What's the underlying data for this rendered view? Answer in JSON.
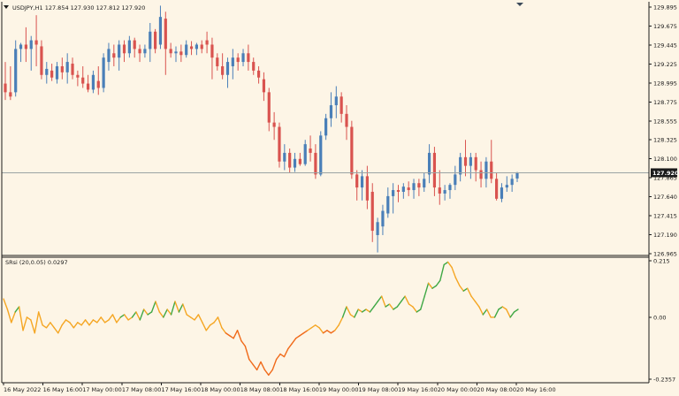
{
  "main_panel": {
    "header": "USDJPY,H1  127.854 127.930 127.812 127.920",
    "current_price": "127.920",
    "price_axis_labels": [
      "129.895",
      "129.675",
      "129.445",
      "129.225",
      "128.995",
      "128.775",
      "128.555",
      "128.325",
      "128.100",
      "127.865",
      "127.640",
      "127.415",
      "127.190",
      "126.965"
    ]
  },
  "indicator_panel": {
    "header": "SRsi (20,0.05) 0.0297",
    "axis_labels": [
      "0.215",
      "0.00",
      "-0.2357"
    ]
  },
  "time_axis_labels": [
    "16 May 2022",
    "16 May 16:00",
    "17 May 00:00",
    "17 May 08:00",
    "17 May 16:00",
    "18 May 00:00",
    "18 May 08:00",
    "18 May 16:00",
    "19 May 00:00",
    "19 May 08:00",
    "19 May 16:00",
    "20 May 00:00",
    "20 May 08:00",
    "20 May 16:00"
  ],
  "colors": {
    "background": "#fdf5e6",
    "bull_candle": "#4a7fb8",
    "bear_candle": "#d9534f",
    "indicator_up": "#3fa845",
    "indicator_neutral": "#f5a623",
    "indicator_down": "#f06a1a",
    "current_price_line": "#9aa4a4"
  },
  "chart_data": [
    {
      "type": "candlestick",
      "symbol": "USDJPY",
      "timeframe": "H1",
      "ylim": [
        126.965,
        129.895
      ],
      "candles": [
        {
          "o": 128.95,
          "h": 129.2,
          "l": 128.76,
          "c": 128.85
        },
        {
          "o": 128.85,
          "h": 129.15,
          "l": 128.76,
          "c": 128.8
        },
        {
          "o": 128.85,
          "h": 129.45,
          "l": 128.8,
          "c": 129.35
        },
        {
          "o": 129.35,
          "h": 129.42,
          "l": 129.2,
          "c": 129.4
        },
        {
          "o": 129.4,
          "h": 129.6,
          "l": 129.2,
          "c": 129.35
        },
        {
          "o": 129.35,
          "h": 129.5,
          "l": 129.1,
          "c": 129.45
        },
        {
          "o": 129.45,
          "h": 129.74,
          "l": 129.15,
          "c": 129.4
        },
        {
          "o": 129.38,
          "h": 129.45,
          "l": 129.0,
          "c": 129.05
        },
        {
          "o": 129.05,
          "h": 129.2,
          "l": 128.95,
          "c": 129.12
        },
        {
          "o": 129.1,
          "h": 129.18,
          "l": 128.98,
          "c": 129.02
        },
        {
          "o": 129.0,
          "h": 129.2,
          "l": 128.95,
          "c": 129.15
        },
        {
          "o": 129.15,
          "h": 129.25,
          "l": 129.0,
          "c": 129.08
        },
        {
          "o": 129.08,
          "h": 129.3,
          "l": 128.95,
          "c": 129.2
        },
        {
          "o": 129.18,
          "h": 129.25,
          "l": 129.0,
          "c": 129.05
        },
        {
          "o": 129.05,
          "h": 129.1,
          "l": 128.92,
          "c": 129.02
        },
        {
          "o": 129.02,
          "h": 129.15,
          "l": 128.9,
          "c": 128.95
        },
        {
          "o": 128.95,
          "h": 129.05,
          "l": 128.85,
          "c": 128.88
        },
        {
          "o": 128.88,
          "h": 129.1,
          "l": 128.84,
          "c": 129.05
        },
        {
          "o": 128.98,
          "h": 129.15,
          "l": 128.82,
          "c": 128.9
        },
        {
          "o": 128.9,
          "h": 129.3,
          "l": 128.85,
          "c": 129.25
        },
        {
          "o": 129.2,
          "h": 129.42,
          "l": 129.1,
          "c": 129.35
        },
        {
          "o": 129.3,
          "h": 129.4,
          "l": 129.15,
          "c": 129.25
        },
        {
          "o": 129.25,
          "h": 129.45,
          "l": 129.1,
          "c": 129.4
        },
        {
          "o": 129.4,
          "h": 129.45,
          "l": 129.2,
          "c": 129.3
        },
        {
          "o": 129.3,
          "h": 129.5,
          "l": 129.25,
          "c": 129.45
        },
        {
          "o": 129.45,
          "h": 129.48,
          "l": 129.25,
          "c": 129.35
        },
        {
          "o": 129.35,
          "h": 129.4,
          "l": 129.2,
          "c": 129.3
        },
        {
          "o": 129.3,
          "h": 129.4,
          "l": 129.25,
          "c": 129.35
        },
        {
          "o": 129.35,
          "h": 129.65,
          "l": 129.2,
          "c": 129.55
        },
        {
          "o": 129.55,
          "h": 129.58,
          "l": 129.3,
          "c": 129.35
        },
        {
          "o": 129.4,
          "h": 129.85,
          "l": 129.35,
          "c": 129.72
        },
        {
          "o": 129.7,
          "h": 129.78,
          "l": 129.05,
          "c": 129.35
        },
        {
          "o": 129.35,
          "h": 129.42,
          "l": 129.25,
          "c": 129.3
        },
        {
          "o": 129.3,
          "h": 129.38,
          "l": 129.2,
          "c": 129.32
        },
        {
          "o": 129.32,
          "h": 129.4,
          "l": 129.2,
          "c": 129.28
        },
        {
          "o": 129.28,
          "h": 129.45,
          "l": 129.25,
          "c": 129.4
        },
        {
          "o": 129.38,
          "h": 129.44,
          "l": 129.28,
          "c": 129.35
        },
        {
          "o": 129.35,
          "h": 129.42,
          "l": 129.28,
          "c": 129.4
        },
        {
          "o": 129.4,
          "h": 129.45,
          "l": 129.3,
          "c": 129.35
        },
        {
          "o": 129.45,
          "h": 129.55,
          "l": 129.3,
          "c": 129.4
        },
        {
          "o": 129.4,
          "h": 129.48,
          "l": 129.0,
          "c": 129.25
        },
        {
          "o": 129.25,
          "h": 129.3,
          "l": 129.1,
          "c": 129.15
        },
        {
          "o": 129.15,
          "h": 129.3,
          "l": 129.0,
          "c": 129.05
        },
        {
          "o": 129.05,
          "h": 129.25,
          "l": 128.9,
          "c": 129.2
        },
        {
          "o": 129.15,
          "h": 129.35,
          "l": 129.0,
          "c": 129.25
        },
        {
          "o": 129.25,
          "h": 129.3,
          "l": 129.1,
          "c": 129.2
        },
        {
          "o": 129.2,
          "h": 129.35,
          "l": 129.15,
          "c": 129.3
        },
        {
          "o": 129.3,
          "h": 129.4,
          "l": 129.1,
          "c": 129.2
        },
        {
          "o": 129.2,
          "h": 129.25,
          "l": 129.05,
          "c": 129.1
        },
        {
          "o": 129.1,
          "h": 129.15,
          "l": 128.95,
          "c": 129.02
        },
        {
          "o": 129.0,
          "h": 129.08,
          "l": 128.75,
          "c": 128.85
        },
        {
          "o": 128.85,
          "h": 128.9,
          "l": 128.4,
          "c": 128.5
        },
        {
          "o": 128.5,
          "h": 128.62,
          "l": 128.3,
          "c": 128.45
        },
        {
          "o": 128.45,
          "h": 128.5,
          "l": 127.98,
          "c": 128.05
        },
        {
          "o": 128.05,
          "h": 128.25,
          "l": 127.95,
          "c": 128.15
        },
        {
          "o": 128.15,
          "h": 128.2,
          "l": 127.92,
          "c": 127.98
        },
        {
          "o": 127.98,
          "h": 128.15,
          "l": 127.93,
          "c": 128.08
        },
        {
          "o": 128.08,
          "h": 128.15,
          "l": 128.0,
          "c": 128.02
        },
        {
          "o": 128.02,
          "h": 128.3,
          "l": 128.0,
          "c": 128.25
        },
        {
          "o": 128.2,
          "h": 128.35,
          "l": 128.05,
          "c": 128.15
        },
        {
          "o": 128.15,
          "h": 128.25,
          "l": 127.85,
          "c": 127.9
        },
        {
          "o": 127.9,
          "h": 128.4,
          "l": 127.88,
          "c": 128.35
        },
        {
          "o": 128.35,
          "h": 128.6,
          "l": 128.3,
          "c": 128.55
        },
        {
          "o": 128.55,
          "h": 128.85,
          "l": 128.45,
          "c": 128.7
        },
        {
          "o": 128.7,
          "h": 128.92,
          "l": 128.55,
          "c": 128.8
        },
        {
          "o": 128.8,
          "h": 128.85,
          "l": 128.5,
          "c": 128.6
        },
        {
          "o": 128.6,
          "h": 128.7,
          "l": 128.3,
          "c": 128.45
        },
        {
          "o": 128.45,
          "h": 128.52,
          "l": 127.85,
          "c": 127.9
        },
        {
          "o": 127.9,
          "h": 127.95,
          "l": 127.6,
          "c": 127.75
        },
        {
          "o": 127.75,
          "h": 127.95,
          "l": 127.6,
          "c": 127.88
        },
        {
          "o": 127.88,
          "h": 128.0,
          "l": 127.5,
          "c": 127.6
        },
        {
          "o": 127.7,
          "h": 127.8,
          "l": 127.12,
          "c": 127.25
        },
        {
          "o": 127.2,
          "h": 127.4,
          "l": 127.0,
          "c": 127.35
        },
        {
          "o": 127.3,
          "h": 127.55,
          "l": 127.2,
          "c": 127.48
        },
        {
          "o": 127.45,
          "h": 127.75,
          "l": 127.4,
          "c": 127.65
        },
        {
          "o": 127.65,
          "h": 127.8,
          "l": 127.45,
          "c": 127.72
        },
        {
          "o": 127.72,
          "h": 127.78,
          "l": 127.58,
          "c": 127.7
        },
        {
          "o": 127.7,
          "h": 127.8,
          "l": 127.62,
          "c": 127.76
        },
        {
          "o": 127.75,
          "h": 127.82,
          "l": 127.65,
          "c": 127.72
        },
        {
          "o": 127.72,
          "h": 127.85,
          "l": 127.62,
          "c": 127.8
        },
        {
          "o": 127.8,
          "h": 127.85,
          "l": 127.65,
          "c": 127.75
        },
        {
          "o": 127.75,
          "h": 127.92,
          "l": 127.7,
          "c": 127.85
        },
        {
          "o": 127.9,
          "h": 128.25,
          "l": 127.8,
          "c": 128.15
        },
        {
          "o": 128.15,
          "h": 128.22,
          "l": 127.65,
          "c": 127.75
        },
        {
          "o": 127.75,
          "h": 127.95,
          "l": 127.55,
          "c": 127.68
        },
        {
          "o": 127.68,
          "h": 127.78,
          "l": 127.6,
          "c": 127.72
        },
        {
          "o": 127.72,
          "h": 127.8,
          "l": 127.62,
          "c": 127.78
        },
        {
          "o": 127.78,
          "h": 128.0,
          "l": 127.72,
          "c": 127.9
        },
        {
          "o": 127.9,
          "h": 128.15,
          "l": 127.82,
          "c": 128.1
        },
        {
          "o": 128.1,
          "h": 128.3,
          "l": 127.88,
          "c": 128.0
        },
        {
          "o": 128.0,
          "h": 128.15,
          "l": 127.85,
          "c": 128.1
        },
        {
          "o": 128.1,
          "h": 128.15,
          "l": 127.82,
          "c": 127.95
        },
        {
          "o": 127.95,
          "h": 128.05,
          "l": 127.75,
          "c": 127.85
        },
        {
          "o": 127.85,
          "h": 128.1,
          "l": 127.75,
          "c": 128.05
        },
        {
          "o": 128.05,
          "h": 128.3,
          "l": 127.8,
          "c": 127.85
        },
        {
          "o": 127.85,
          "h": 127.92,
          "l": 127.6,
          "c": 127.62
        },
        {
          "o": 127.62,
          "h": 127.8,
          "l": 127.58,
          "c": 127.75
        },
        {
          "o": 127.75,
          "h": 127.88,
          "l": 127.7,
          "c": 127.78
        },
        {
          "o": 127.78,
          "h": 127.9,
          "l": 127.7,
          "c": 127.85
        },
        {
          "o": 127.854,
          "h": 127.93,
          "l": 127.812,
          "c": 127.92
        }
      ]
    },
    {
      "type": "line",
      "name": "SRsi (20,0.05)",
      "ylim": [
        -0.2357,
        0.215
      ],
      "zero_line": 0.0,
      "values": [
        0.07,
        0.03,
        -0.02,
        0.02,
        0.04,
        -0.05,
        0.0,
        -0.01,
        -0.06,
        0.02,
        -0.03,
        -0.04,
        -0.02,
        -0.04,
        -0.06,
        -0.03,
        -0.01,
        -0.02,
        -0.04,
        -0.02,
        -0.03,
        -0.01,
        -0.03,
        -0.01,
        -0.02,
        0.0,
        -0.02,
        -0.01,
        0.01,
        -0.02,
        0.0,
        0.01,
        -0.01,
        0.0,
        0.02,
        -0.01,
        0.03,
        0.01,
        0.02,
        0.06,
        0.02,
        0.0,
        0.03,
        0.01,
        0.06,
        0.02,
        0.05,
        0.01,
        0.0,
        -0.01,
        0.01,
        -0.02,
        -0.05,
        -0.03,
        -0.02,
        0.0,
        -0.04,
        -0.06,
        -0.07,
        -0.08,
        -0.05,
        -0.09,
        -0.11,
        -0.16,
        -0.18,
        -0.2,
        -0.17,
        -0.2,
        -0.22,
        -0.2,
        -0.16,
        -0.14,
        -0.15,
        -0.12,
        -0.1,
        -0.08,
        -0.07,
        -0.06,
        -0.05,
        -0.04,
        -0.03,
        -0.04,
        -0.06,
        -0.05,
        -0.06,
        -0.05,
        -0.03,
        0.0,
        0.04,
        0.01,
        0.0,
        0.03,
        0.02,
        0.03,
        0.02,
        0.04,
        0.06,
        0.08,
        0.04,
        0.05,
        0.03,
        0.04,
        0.06,
        0.08,
        0.05,
        0.04,
        0.02,
        0.03,
        0.08,
        0.13,
        0.11,
        0.12,
        0.14,
        0.2,
        0.21,
        0.19,
        0.15,
        0.12,
        0.1,
        0.11,
        0.08,
        0.06,
        0.04,
        0.01,
        0.03,
        0.0,
        0.0,
        0.03,
        0.04,
        0.03,
        0.0,
        0.02,
        0.03
      ]
    }
  ]
}
